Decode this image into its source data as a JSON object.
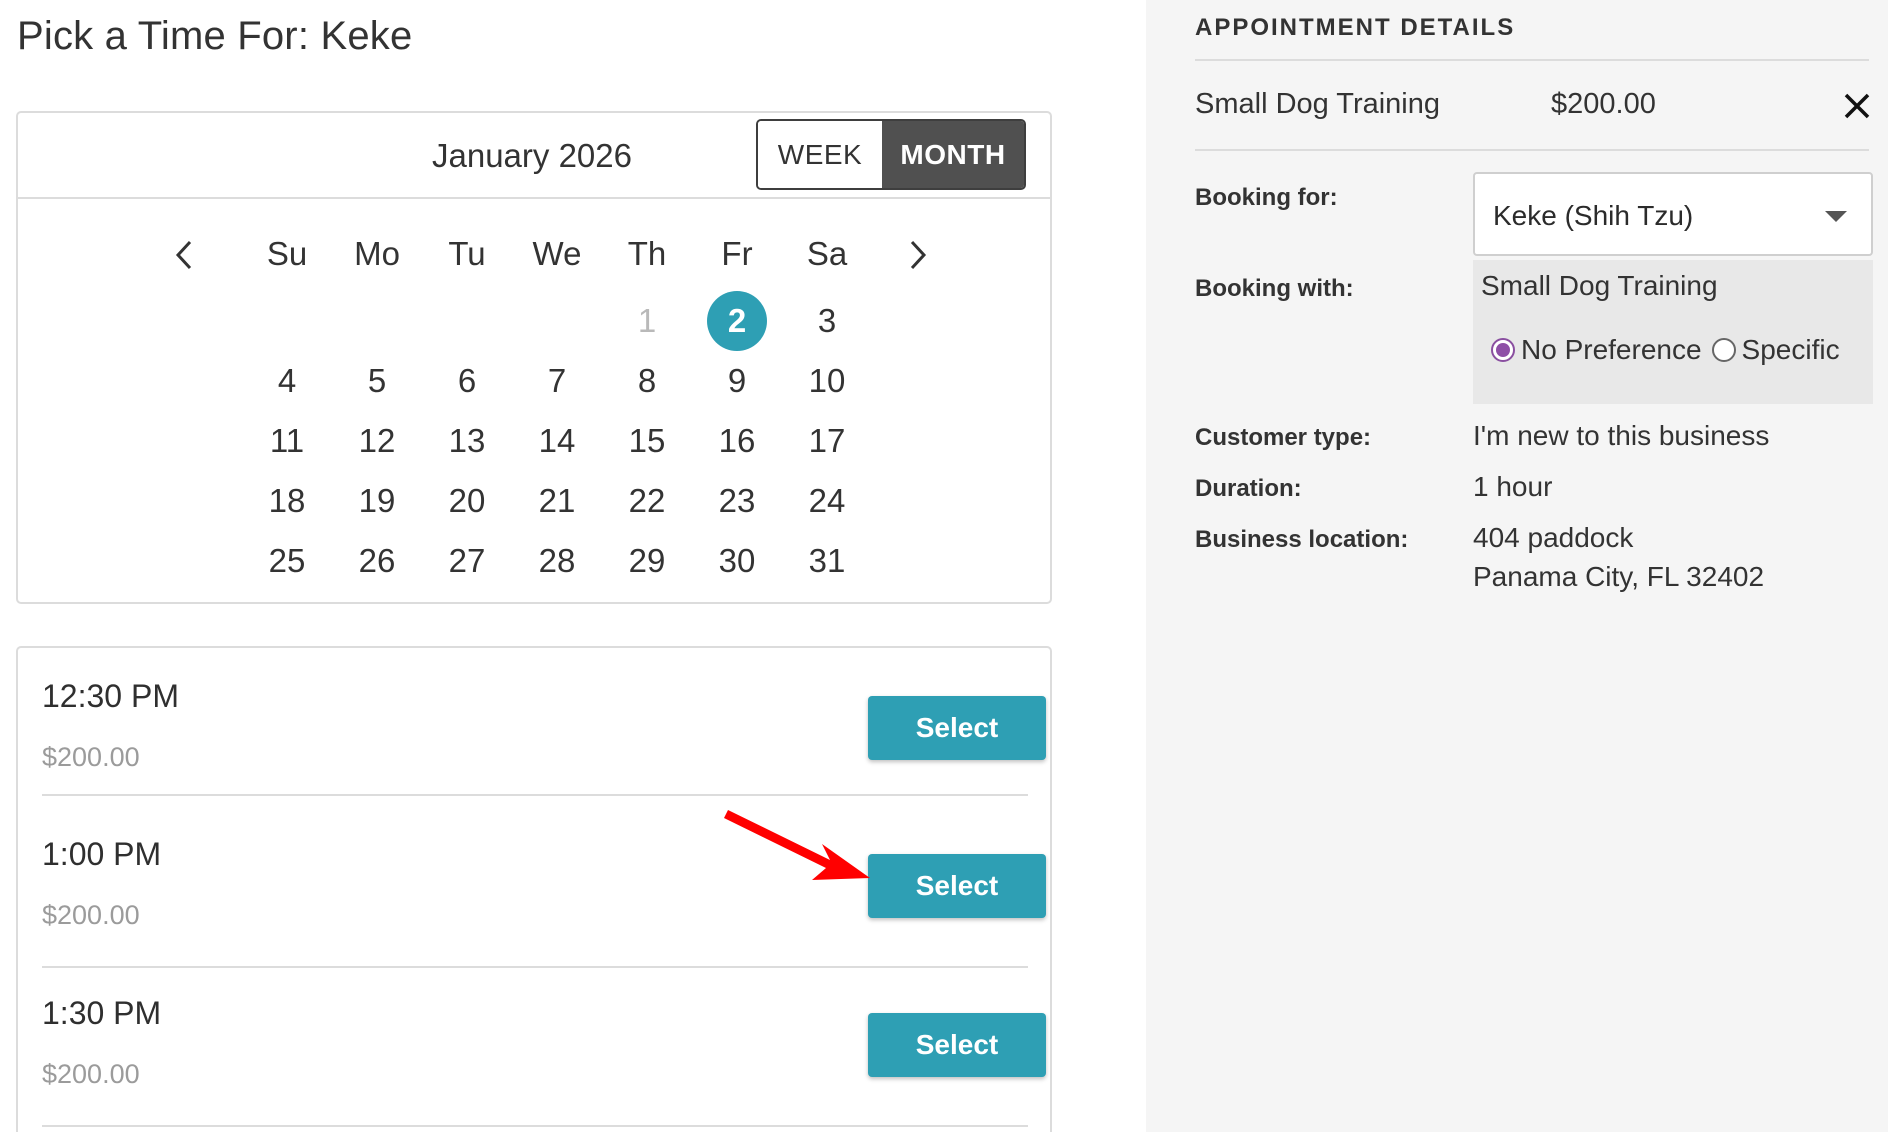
{
  "page_title": "Pick a Time For: Keke",
  "calendar": {
    "month_label": "January 2026",
    "view_week": "WEEK",
    "view_month": "MONTH",
    "active_view": "MONTH",
    "weekdays": [
      "Su",
      "Mo",
      "Tu",
      "We",
      "Th",
      "Fr",
      "Sa"
    ],
    "weeks": [
      [
        "",
        "",
        "",
        "",
        "1",
        "2",
        "3"
      ],
      [
        "4",
        "5",
        "6",
        "7",
        "8",
        "9",
        "10"
      ],
      [
        "11",
        "12",
        "13",
        "14",
        "15",
        "16",
        "17"
      ],
      [
        "18",
        "19",
        "20",
        "21",
        "22",
        "23",
        "24"
      ],
      [
        "25",
        "26",
        "27",
        "28",
        "29",
        "30",
        "31"
      ]
    ],
    "muted_day": "1",
    "selected_day": "2",
    "accent_color": "#2e9fb4"
  },
  "slots": [
    {
      "time": "12:30 PM",
      "price": "$200.00",
      "button": "Select"
    },
    {
      "time": "1:00 PM",
      "price": "$200.00",
      "button": "Select"
    },
    {
      "time": "1:30 PM",
      "price": "$200.00",
      "button": "Select"
    }
  ],
  "details": {
    "heading": "APPOINTMENT DETAILS",
    "service_name": "Small Dog Training",
    "service_price": "$200.00",
    "booking_for_label": "Booking for:",
    "booking_for_value": "Keke (Shih Tzu)",
    "booking_with_label": "Booking with:",
    "booking_with_value": "Small Dog Training",
    "preference_options": [
      "No Preference",
      "Specific"
    ],
    "preference_selected": "No Preference",
    "customer_type_label": "Customer type:",
    "customer_type_value": "I'm new to this business",
    "duration_label": "Duration:",
    "duration_value": "1 hour",
    "location_label": "Business location:",
    "location_line1": "404 paddock",
    "location_line2": "Panama City, FL 32402"
  },
  "icons": {
    "prev": "chevron-left-icon",
    "next": "chevron-right-icon",
    "remove": "close-icon",
    "dropdown": "caret-down-icon",
    "annotation": "red-arrow-icon"
  },
  "colors": {
    "annotation_arrow": "#ff0000",
    "radio_selected": "#8e4fa6",
    "panel_bg": "#f5f5f5"
  }
}
